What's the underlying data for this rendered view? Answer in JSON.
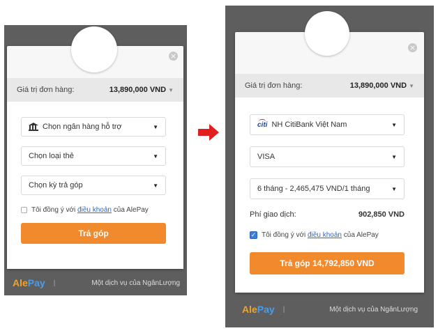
{
  "left": {
    "order_label": "Giá trị đơn hàng:",
    "order_value": "13,890,000 VND",
    "bank_select": "Chọn ngân hàng hỗ trợ",
    "card_select": "Chọn loại thẻ",
    "term_select": "Chọn kỳ trả góp",
    "agree_prefix": "Tôi đồng ý với",
    "agree_link": "điều khoản",
    "agree_suffix": "của AlePay",
    "button_label": "Trả góp",
    "footer_text": "Một dịch vụ của NgânLượng"
  },
  "right": {
    "order_label": "Giá trị đơn hàng:",
    "order_value": "13,890,000 VND",
    "bank_select": "NH CitiBank Việt Nam",
    "bank_logo_text": "citi",
    "card_select": "VISA",
    "term_select": "6 tháng - 2,465,475 VND/1 tháng",
    "fee_label": "Phí giao dịch:",
    "fee_value": "902,850 VND",
    "agree_prefix": "Tôi đồng ý với",
    "agree_link": "điều khoản",
    "agree_suffix": "của AlePay",
    "button_label": "Trả góp 14,792,850 VND",
    "footer_text": "Một dịch vụ của NgânLượng"
  },
  "brand": {
    "logo_ale": "Ale",
    "logo_pay": "Pay",
    "accent_color": "#f08a2c",
    "arrow_color": "#e02020"
  },
  "icons": {
    "close": "close-icon",
    "dropdown": "chevron-down-icon",
    "bank": "bank-icon",
    "transition": "arrow-right-icon"
  }
}
